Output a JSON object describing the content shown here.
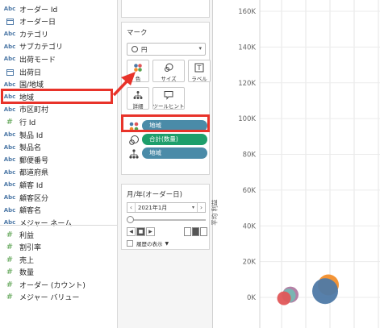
{
  "data_pane": {
    "fields": [
      {
        "type": "Abc",
        "label": "オーダー Id"
      },
      {
        "type": "date",
        "label": "オーダー日"
      },
      {
        "type": "Abc",
        "label": "カテゴリ"
      },
      {
        "type": "Abc",
        "label": "サブカテゴリ"
      },
      {
        "type": "Abc",
        "label": "出荷モード"
      },
      {
        "type": "date",
        "label": "出荷日"
      },
      {
        "type": "Abc",
        "label": "国/地域"
      },
      {
        "type": "Abc",
        "label": "地域"
      },
      {
        "type": "Abc",
        "label": "市区町村"
      },
      {
        "type": "#",
        "label": "行 Id"
      },
      {
        "type": "Abc",
        "label": "製品 Id"
      },
      {
        "type": "Abc",
        "label": "製品名"
      },
      {
        "type": "Abc",
        "label": "郵便番号"
      },
      {
        "type": "Abc",
        "label": "都道府県"
      },
      {
        "type": "Abc",
        "label": "顧客 Id"
      },
      {
        "type": "Abc",
        "label": "顧客区分"
      },
      {
        "type": "Abc",
        "label": "顧客名"
      },
      {
        "type": "Abc",
        "label": "メジャー ネーム"
      }
    ],
    "measures": [
      {
        "type": "#",
        "label": "利益"
      },
      {
        "type": "#",
        "label": "割引率"
      },
      {
        "type": "#",
        "label": "売上"
      },
      {
        "type": "#",
        "label": "数量"
      },
      {
        "type": "#",
        "label": "オーダー (カウント)"
      },
      {
        "type": "#",
        "label": "メジャー バリュー"
      }
    ]
  },
  "marks_card": {
    "title": "マーク",
    "mark_type": "円",
    "buttons": {
      "color": "色",
      "size": "サイズ",
      "label": "ラベル",
      "detail": "詳細",
      "tooltip": "ツールヒント"
    },
    "pills": {
      "color_field": "地域",
      "size_field": "合計(数量)",
      "detail_field": "地域"
    }
  },
  "pages_card": {
    "title": "月/年(オーダー日)",
    "current_value": "2021年1月",
    "history_label": "履歴の表示"
  },
  "colors": {
    "highlight": "#e8332a",
    "pill_blue": "#4a8ba8",
    "pill_green": "#1d9e6b",
    "region_colors": [
      "#4e79a7",
      "#f28e2b",
      "#e15759",
      "#76b7b2",
      "#b07aa1"
    ]
  },
  "chart": {
    "y_axis_title": "平均 利益",
    "y_ticks": [
      "160K",
      "140K",
      "120K",
      "100K",
      "80K",
      "60K",
      "40K",
      "20K",
      "0K"
    ]
  },
  "chart_data": {
    "type": "scatter",
    "ylabel": "平均 利益",
    "yticks": [
      "0K",
      "20K",
      "40K",
      "60K",
      "80K",
      "100K",
      "120K",
      "140K",
      "160K"
    ],
    "ylim": [
      0,
      160000
    ],
    "points": [
      {
        "y": 7000,
        "size": 3,
        "color": "#f28e2b"
      },
      {
        "y": 3500,
        "size": 4,
        "color": "#4e79a7"
      },
      {
        "y": 1500,
        "size": 2,
        "color": "#b07aa1"
      },
      {
        "y": 1000,
        "size": 1.5,
        "color": "#76b7b2"
      },
      {
        "y": -500,
        "size": 1.5,
        "color": "#e15759"
      }
    ]
  }
}
